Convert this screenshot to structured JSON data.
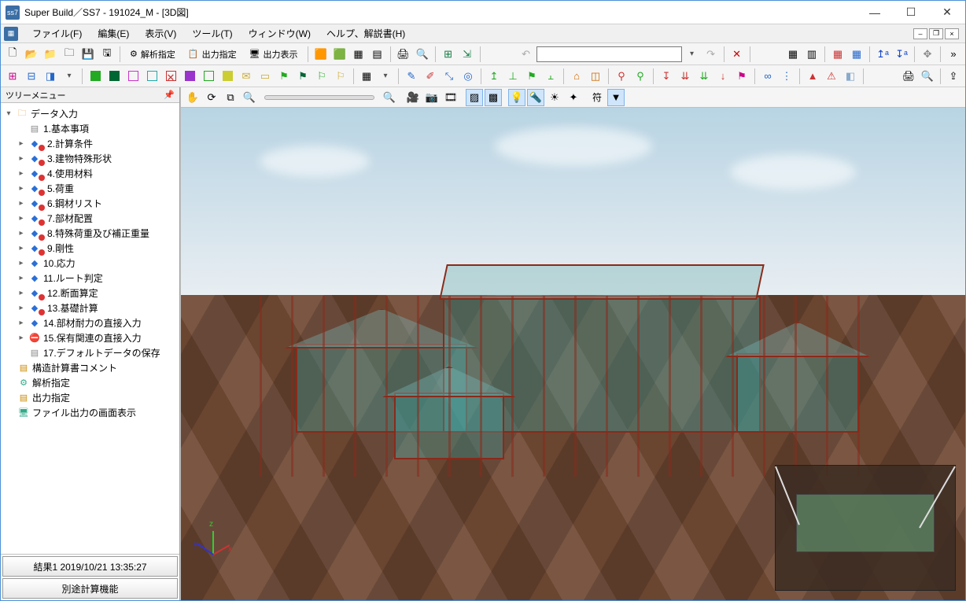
{
  "window": {
    "title": "Super Build／SS7 - 191024_M - [3D図]"
  },
  "menu": {
    "file": "ファイル(F)",
    "edit": "編集(E)",
    "view": "表示(V)",
    "tool": "ツール(T)",
    "window": "ウィンドウ(W)",
    "help": "ヘルプ、解説書(H)"
  },
  "toolbar1": {
    "analysis_spec": "解析指定",
    "output_spec": "出力指定",
    "output_display": "出力表示"
  },
  "view_toolbar": {
    "annotation": "符"
  },
  "side": {
    "header": "ツリーメニュー",
    "root": "データ入力",
    "items": [
      "1.基本事項",
      "2.計算条件",
      "3.建物特殊形状",
      "4.使用材料",
      "5.荷重",
      "6.鋼材リスト",
      "7.部材配置",
      "8.特殊荷重及び補正重量",
      "9.剛性",
      "10.応力",
      "11.ルート判定",
      "12.断面算定",
      "13.基礎計算",
      "14.部材耐力の直接入力",
      "15.保有関連の直接入力",
      "17.デフォルトデータの保存"
    ],
    "extra": [
      "構造計算書コメント",
      "解析指定",
      "出力指定",
      "ファイル出力の画面表示"
    ],
    "footer1": "結果1  2019/10/21 13:35:27",
    "footer2": "別途計算機能"
  }
}
